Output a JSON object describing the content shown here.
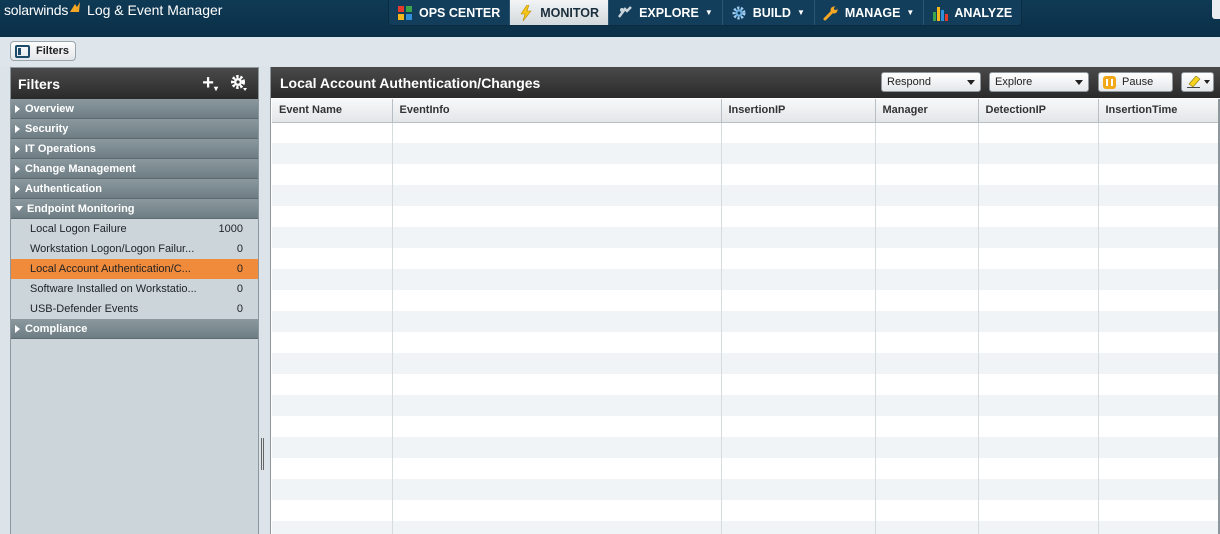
{
  "app": {
    "brand": "solarwinds",
    "product": "Log & Event Manager"
  },
  "nav": {
    "tabs": [
      {
        "label": "OPS CENTER",
        "icon": "ops-center-icon",
        "dropdown": false,
        "active": false
      },
      {
        "label": "MONITOR",
        "icon": "lightning-icon",
        "dropdown": false,
        "active": true
      },
      {
        "label": "EXPLORE",
        "icon": "explore-icon",
        "dropdown": true,
        "active": false
      },
      {
        "label": "BUILD",
        "icon": "gear-icon",
        "dropdown": true,
        "active": false
      },
      {
        "label": "MANAGE",
        "icon": "wrench-icon",
        "dropdown": true,
        "active": false
      },
      {
        "label": "ANALYZE",
        "icon": "bar-chart-icon",
        "dropdown": false,
        "active": false
      }
    ]
  },
  "toolbar": {
    "filters_toggle_label": "Filters"
  },
  "filters_panel": {
    "title": "Filters",
    "groups": [
      {
        "label": "Overview",
        "expanded": false,
        "items": []
      },
      {
        "label": "Security",
        "expanded": false,
        "items": []
      },
      {
        "label": "IT Operations",
        "expanded": false,
        "items": []
      },
      {
        "label": "Change Management",
        "expanded": false,
        "items": []
      },
      {
        "label": "Authentication",
        "expanded": false,
        "items": []
      },
      {
        "label": "Endpoint Monitoring",
        "expanded": true,
        "items": [
          {
            "name": "Local Logon Failure",
            "count": "1000",
            "selected": false
          },
          {
            "name": "Workstation Logon/Logon Failur...",
            "count": "0",
            "selected": false
          },
          {
            "name": "Local Account Authentication/C...",
            "count": "0",
            "selected": true
          },
          {
            "name": "Software Installed on Workstatio...",
            "count": "0",
            "selected": false
          },
          {
            "name": "USB-Defender Events",
            "count": "0",
            "selected": false
          }
        ]
      },
      {
        "label": "Compliance",
        "expanded": false,
        "items": []
      }
    ]
  },
  "main_panel": {
    "title": "Local Account Authentication/Changes",
    "respond_label": "Respond",
    "explore_label": "Explore",
    "pause_label": "Pause",
    "columns": [
      "Event Name",
      "EventInfo",
      "InsertionIP",
      "Manager",
      "DetectionIP",
      "InsertionTime"
    ],
    "rows": []
  },
  "colors": {
    "topbar": "#0f3a55",
    "selected_item": "#f08b3c",
    "panel_header": "#333333",
    "group_header": "#7d8b91"
  }
}
